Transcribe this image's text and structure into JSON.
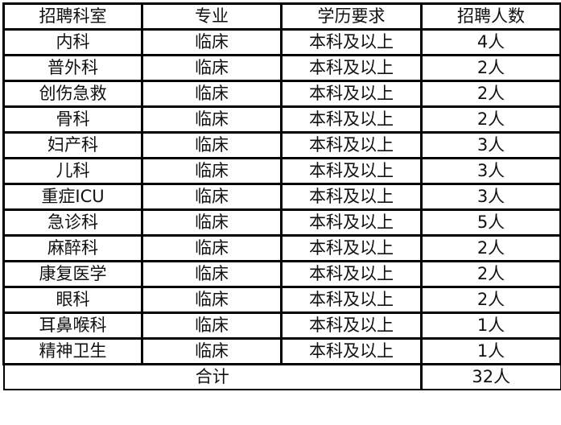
{
  "table": {
    "headers": [
      "招聘科室",
      "专业",
      "学历要求",
      "招聘人数"
    ],
    "rows": [
      {
        "department": "内科",
        "major": "临床",
        "education": "本科及以上",
        "count": "4人"
      },
      {
        "department": "普外科",
        "major": "临床",
        "education": "本科及以上",
        "count": "2人"
      },
      {
        "department": "创伤急救",
        "major": "临床",
        "education": "本科及以上",
        "count": "2人"
      },
      {
        "department": "骨科",
        "major": "临床",
        "education": "本科及以上",
        "count": "2人"
      },
      {
        "department": "妇产科",
        "major": "临床",
        "education": "本科及以上",
        "count": "3人"
      },
      {
        "department": "儿科",
        "major": "临床",
        "education": "本科及以上",
        "count": "3人"
      },
      {
        "department": "重症ICU",
        "major": "临床",
        "education": "本科及以上",
        "count": "3人"
      },
      {
        "department": "急诊科",
        "major": "临床",
        "education": "本科及以上",
        "count": "5人"
      },
      {
        "department": "麻醉科",
        "major": "临床",
        "education": "本科及以上",
        "count": "2人"
      },
      {
        "department": "康复医学",
        "major": "临床",
        "education": "本科及以上",
        "count": "2人"
      },
      {
        "department": "眼科",
        "major": "临床",
        "education": "本科及以上",
        "count": "2人"
      },
      {
        "department": "耳鼻喉科",
        "major": "临床",
        "education": "本科及以上",
        "count": "1人"
      },
      {
        "department": "精神卫生",
        "major": "临床",
        "education": "本科及以上",
        "count": "1人"
      }
    ],
    "total": {
      "label": "合计",
      "value": "32人"
    }
  }
}
